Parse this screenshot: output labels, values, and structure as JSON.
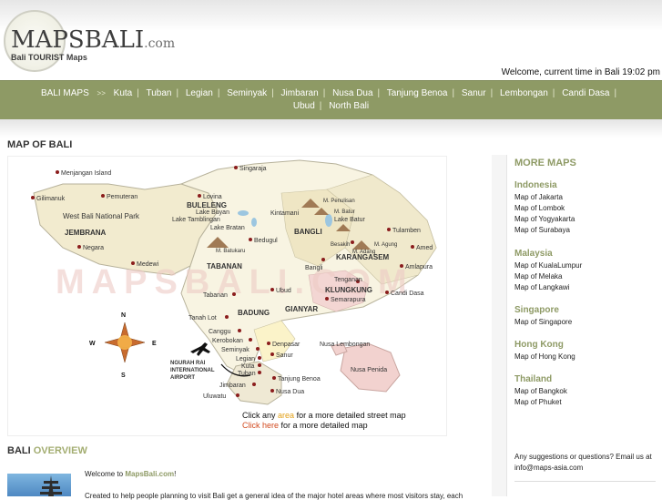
{
  "logo": {
    "main": "MAPSBALI",
    "dot": ".com",
    "sub": "Bali TOURIST Maps"
  },
  "welcome": "Welcome, current time in Bali 19:02 pm",
  "nav": {
    "home": "BALI MAPS",
    "arrow": ">>",
    "links_row1": [
      "Kuta",
      "Tuban",
      "Legian",
      "Seminyak",
      "Jimbaran",
      "Nusa Dua",
      "Tanjung Benoa",
      "Sanur",
      "Lembongan",
      "Candi Dasa"
    ],
    "links_row2": [
      "Ubud",
      "North Bali"
    ],
    "separator": "|"
  },
  "page_title": "MAP OF BALI",
  "map": {
    "watermark": "MAPSBALI.COM",
    "compass": {
      "n": "N",
      "s": "S",
      "e": "E",
      "w": "W"
    },
    "places": {
      "menjangan": "Menjangan Island",
      "gilimanuk": "Gilimanuk",
      "pemuteran": "Pemuteran",
      "westpark": "West Bali National Park",
      "jembrana": "JEMBRANA",
      "negara": "Negara",
      "medewi": "Medewi",
      "singaraja": "Singaraja",
      "buleleng": "BULELENG",
      "lovina": "Lovina",
      "lakebuyan": "Lake Buyan",
      "laketamblingan": "Lake Tamblingan",
      "lakebratan": "Lake Bratan",
      "kintamani": "Kintamani",
      "mpenulisan": "M. Penulisan",
      "mbatur": "M. Batur",
      "lakebatur": "Lake Batur",
      "bangli": "BANGLI",
      "bangli2": "Bangli",
      "besakih": "Besakih",
      "magung": "M. Agung",
      "madang": "M. Adang",
      "karangasem": "KARANGASEM",
      "tulamben": "Tulamben",
      "amed": "Amed",
      "amlapura": "Amlapura",
      "candidasa": "Candi Dasa",
      "klungkung": "KLUNGKUNG",
      "tenganan": "Tenganan",
      "semarapura": "Semarapura",
      "bedugul": "Bedugul",
      "mbatukaru": "M. Batukaru",
      "tabanan": "TABANAN",
      "tabanan2": "Tabanan",
      "ubud": "Ubud",
      "gianyar": "GIANYAR",
      "badung": "BADUNG",
      "tanahlot": "Tanah Lot",
      "canggu": "Canggu",
      "kerobokan": "Kerobokan",
      "seminyak": "Seminyak",
      "legian": "Legian",
      "kuta": "Kuta",
      "tuban": "Tuban",
      "denpasar": "Denpasar",
      "sanur": "Sanur",
      "tanjungbenoa": "Tanjung Benoa",
      "jimbaran": "Jimbaran",
      "nusadua": "Nusa Dua",
      "uluwatu": "Uluwatu",
      "nusalembongan": "Nusa Lembongan",
      "nusapenida": "Nusa Penida",
      "airport1": "NGURAH RAI",
      "airport2": "INTERNATIONAL",
      "airport3": "AIRPORT"
    },
    "caption1": {
      "pre": "Click any",
      "link": "area",
      "post": "for a more detailed street map"
    },
    "caption2": {
      "link": "Click here",
      "post": "for a more detailed map"
    }
  },
  "more_maps": {
    "title": "MORE MAPS",
    "groups": [
      {
        "name": "Indonesia",
        "items": [
          "Map of Jakarta",
          "Map of Lombok",
          "Map of Yogyakarta",
          "Map of Surabaya"
        ]
      },
      {
        "name": "Malaysia",
        "items": [
          "Map of KualaLumpur",
          "Map of Melaka",
          "Map of Langkawi"
        ]
      },
      {
        "name": "Singapore",
        "items": [
          "Map of Singapore"
        ]
      },
      {
        "name": "Hong Kong",
        "items": [
          "Map of Hong Kong"
        ]
      },
      {
        "name": "Thailand",
        "items": [
          "Map of Bangkok",
          "Map of Phuket"
        ]
      }
    ],
    "suggest": "Any suggestions or questions? Email us at info@maps-asia.com"
  },
  "overview": {
    "title_a": "BALI",
    "title_b": "OVERVIEW",
    "welcome_pre": "Welcome to",
    "welcome_link": "MapsBali.com",
    "welcome_post": "!",
    "intro": "Created to help people planning to visit Bali get a general idea of the major hotel areas where most visitors stay, each"
  },
  "colors": {
    "nav": "#8e9a65",
    "accent": "#8e9a65",
    "link_yellow": "#e2a018",
    "link_red": "#d24a1f"
  }
}
